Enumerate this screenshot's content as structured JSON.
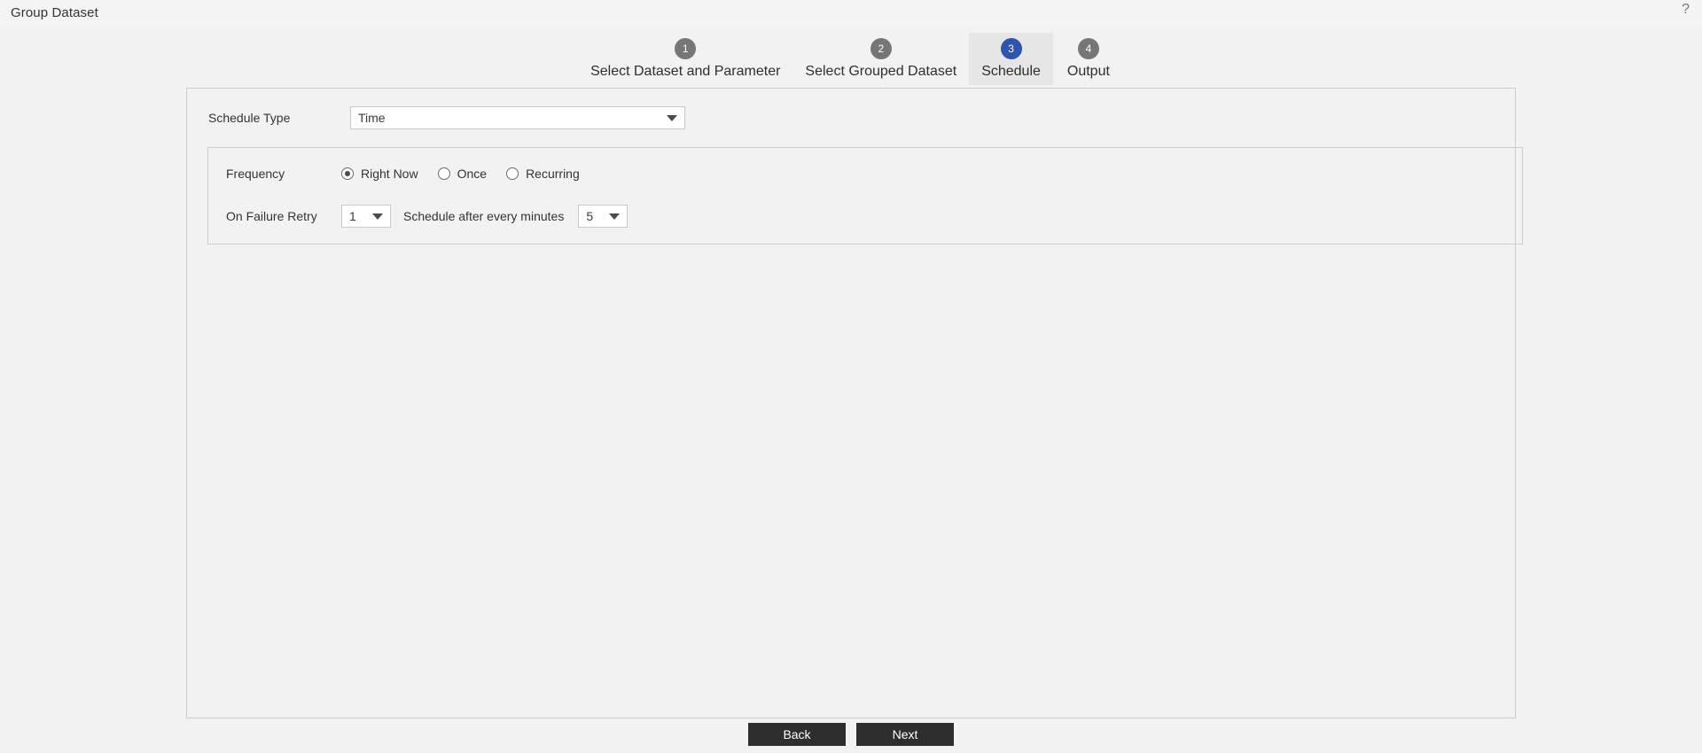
{
  "header": {
    "title": "Group Dataset",
    "help_icon": "question-mark-icon",
    "help_glyph": "?"
  },
  "stepper": {
    "steps": [
      {
        "number": "1",
        "label": "Select Dataset and Parameter",
        "active": false
      },
      {
        "number": "2",
        "label": "Select Grouped Dataset",
        "active": false
      },
      {
        "number": "3",
        "label": "Schedule",
        "active": true
      },
      {
        "number": "4",
        "label": "Output",
        "active": false
      }
    ],
    "active_circle_color": "#2f54ad",
    "inactive_circle_color": "#767676",
    "active_background": "#e6e6e6"
  },
  "form": {
    "schedule_type": {
      "label": "Schedule Type",
      "value": "Time",
      "options": [
        "Time"
      ]
    },
    "frequency": {
      "label": "Frequency",
      "selected": "Right Now",
      "options": [
        {
          "label": "Right Now",
          "checked": true
        },
        {
          "label": "Once",
          "checked": false
        },
        {
          "label": "Recurring",
          "checked": false
        }
      ]
    },
    "on_failure_retry": {
      "label": "On Failure Retry",
      "value": "1",
      "options": [
        "1"
      ]
    },
    "schedule_after": {
      "label": "Schedule after every minutes",
      "value": "5",
      "options": [
        "5"
      ]
    }
  },
  "footer": {
    "back_label": "Back",
    "next_label": "Next",
    "button_color": "#2e2e2e"
  }
}
